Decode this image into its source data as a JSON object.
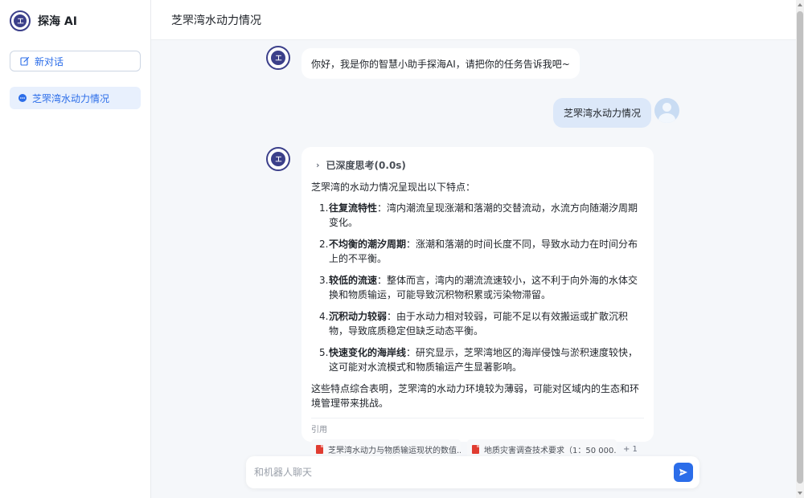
{
  "app": {
    "name": "探海 AI",
    "logo_mark": "工"
  },
  "sidebar": {
    "new_chat_label": "新对话",
    "conversations": [
      {
        "label": "芝罘湾水动力情况"
      }
    ]
  },
  "header": {
    "title": "芝罘湾水动力情况"
  },
  "chat": {
    "greeting": "你好，我是你的智慧小助手探海AI，请把你的任务告诉我吧~",
    "user_message": "芝罘湾水动力情况",
    "thinking_label": "已深度思考(0.0s)",
    "answer_intro": "芝罘湾的水动力情况呈现出以下特点：",
    "points": [
      {
        "num": "1.",
        "title": "往复流特性",
        "text": "：湾内潮流呈现涨潮和落潮的交替流动，水流方向随潮汐周期变化。"
      },
      {
        "num": "2.",
        "title": "不均衡的潮汐周期",
        "text": "：涨潮和落潮的时间长度不同，导致水动力在时间分布上的不平衡。"
      },
      {
        "num": "3.",
        "title": "较低的流速",
        "text": "：整体而言，湾内的潮流流速较小，这不利于向外海的水体交换和物质输运，可能导致沉积物积累或污染物滞留。"
      },
      {
        "num": "4.",
        "title": "沉积动力较弱",
        "text": "：由于水动力相对较弱，可能不足以有效搬运或扩散沉积物，导致底质稳定但缺乏动态平衡。"
      },
      {
        "num": "5.",
        "title": "快速变化的海岸线",
        "text": "：研究显示，芝罘湾地区的海岸侵蚀与淤积速度较快，这可能对水流模式和物质输运产生显著影响。"
      }
    ],
    "answer_conclusion": "这些特点综合表明，芝罘湾的水动力环境较为薄弱，可能对区域内的生态和环境管理带来挑战。",
    "references_label": "引用",
    "references": [
      {
        "title": "芝罘湾水动力与物质输运现状的数值..."
      },
      {
        "title": "地质灾害调查技术要求（1：50 000..."
      }
    ],
    "references_more": "+ 1"
  },
  "composer": {
    "placeholder": "和机器人聊天"
  },
  "colors": {
    "accent": "#2b6de9",
    "logo": "#3b3f8a",
    "user_bubble": "#dce8f9"
  }
}
